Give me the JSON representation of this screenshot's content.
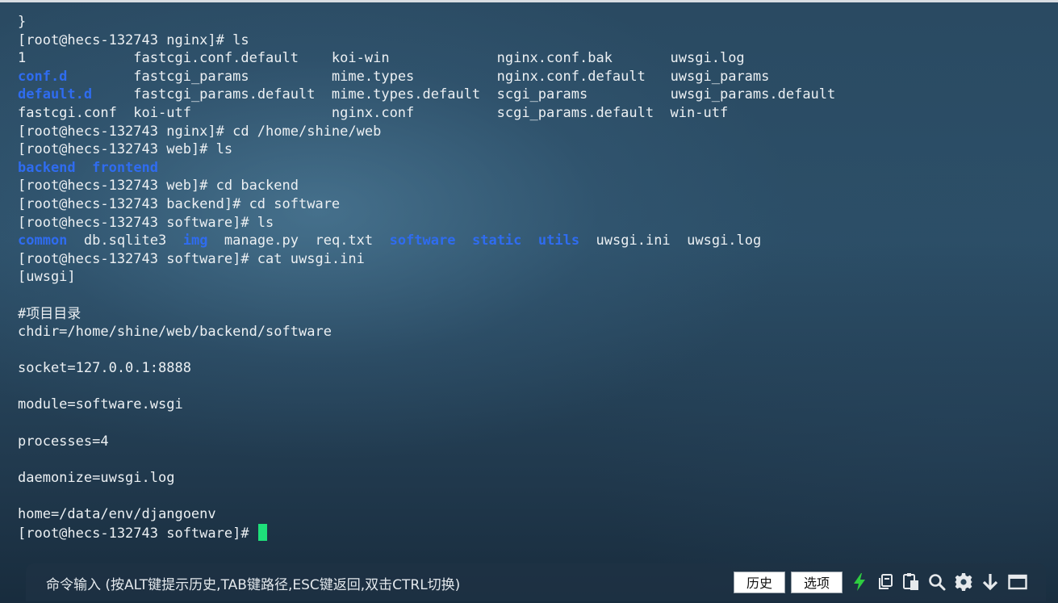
{
  "terminal": {
    "lines": [
      [
        {
          "t": "}"
        }
      ],
      [
        {
          "t": "[root@hecs-132743 nginx]# ls"
        }
      ],
      [
        {
          "t": "1             fastcgi.conf.default    koi-win             nginx.conf.bak       uwsgi.log"
        }
      ],
      [
        {
          "t": "conf.d",
          "dir": true
        },
        {
          "t": "        fastcgi_params          mime.types          nginx.conf.default   uwsgi_params"
        }
      ],
      [
        {
          "t": "default.d",
          "dir": true
        },
        {
          "t": "     fastcgi_params.default  mime.types.default  scgi_params          uwsgi_params.default"
        }
      ],
      [
        {
          "t": "fastcgi.conf  koi-utf                 nginx.conf          scgi_params.default  win-utf"
        }
      ],
      [
        {
          "t": "[root@hecs-132743 nginx]# cd /home/shine/web"
        }
      ],
      [
        {
          "t": "[root@hecs-132743 web]# ls"
        }
      ],
      [
        {
          "t": "backend",
          "dir": true
        },
        {
          "t": "  "
        },
        {
          "t": "frontend",
          "dir": true
        }
      ],
      [
        {
          "t": "[root@hecs-132743 web]# cd backend"
        }
      ],
      [
        {
          "t": "[root@hecs-132743 backend]# cd software"
        }
      ],
      [
        {
          "t": "[root@hecs-132743 software]# ls"
        }
      ],
      [
        {
          "t": "common",
          "dir": true
        },
        {
          "t": "  db.sqlite3  "
        },
        {
          "t": "img",
          "dir": true
        },
        {
          "t": "  manage.py  req.txt  "
        },
        {
          "t": "software",
          "dir": true
        },
        {
          "t": "  "
        },
        {
          "t": "static",
          "dir": true
        },
        {
          "t": "  "
        },
        {
          "t": "utils",
          "dir": true
        },
        {
          "t": "  uwsgi.ini  uwsgi.log"
        }
      ],
      [
        {
          "t": "[root@hecs-132743 software]# cat uwsgi.ini"
        }
      ],
      [
        {
          "t": "[uwsgi]"
        }
      ],
      [
        {
          "t": ""
        }
      ],
      [
        {
          "t": "#项目目录"
        }
      ],
      [
        {
          "t": "chdir=/home/shine/web/backend/software"
        }
      ],
      [
        {
          "t": ""
        }
      ],
      [
        {
          "t": "socket=127.0.0.1:8888"
        }
      ],
      [
        {
          "t": ""
        }
      ],
      [
        {
          "t": "module=software.wsgi"
        }
      ],
      [
        {
          "t": ""
        }
      ],
      [
        {
          "t": "processes=4"
        }
      ],
      [
        {
          "t": ""
        }
      ],
      [
        {
          "t": "daemonize=uwsgi.log"
        }
      ],
      [
        {
          "t": ""
        }
      ],
      [
        {
          "t": "home=/data/env/djangoenv"
        }
      ],
      [
        {
          "t": "[root@hecs-132743 software]# "
        }
      ]
    ],
    "dir_color": "#2f6cf0",
    "text_color": "#ecf0f3",
    "cursor_color": "#1ee07a"
  },
  "bottom_bar": {
    "command_hint": "命令输入 (按ALT键提示历史,TAB键路径,ESC键返回,双击CTRL切换)",
    "history_label": "历史",
    "options_label": "选项",
    "icons": [
      "lightning-icon",
      "copy-icon",
      "paste-icon",
      "search-icon",
      "gear-icon",
      "download-arrow-icon",
      "window-icon"
    ],
    "lightning_color": "#2ecc40"
  }
}
